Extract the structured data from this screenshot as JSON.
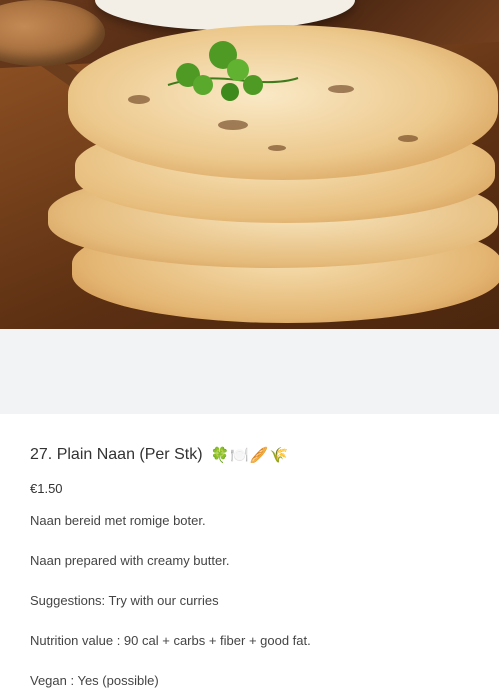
{
  "item": {
    "number_name": "27. Plain Naan (Per Stk)",
    "icons": "🍀🍽️🥖🌾",
    "price": "€1.50",
    "lines": [
      "Naan bereid met romige boter.",
      "Naan prepared with creamy butter.",
      "Suggestions: Try with our curries",
      "Nutrition value : 90 cal + carbs + fiber + good fat.",
      "Vegan : Yes (possible)"
    ]
  },
  "image": {
    "semantic": "naan-bread-stack-photo"
  }
}
